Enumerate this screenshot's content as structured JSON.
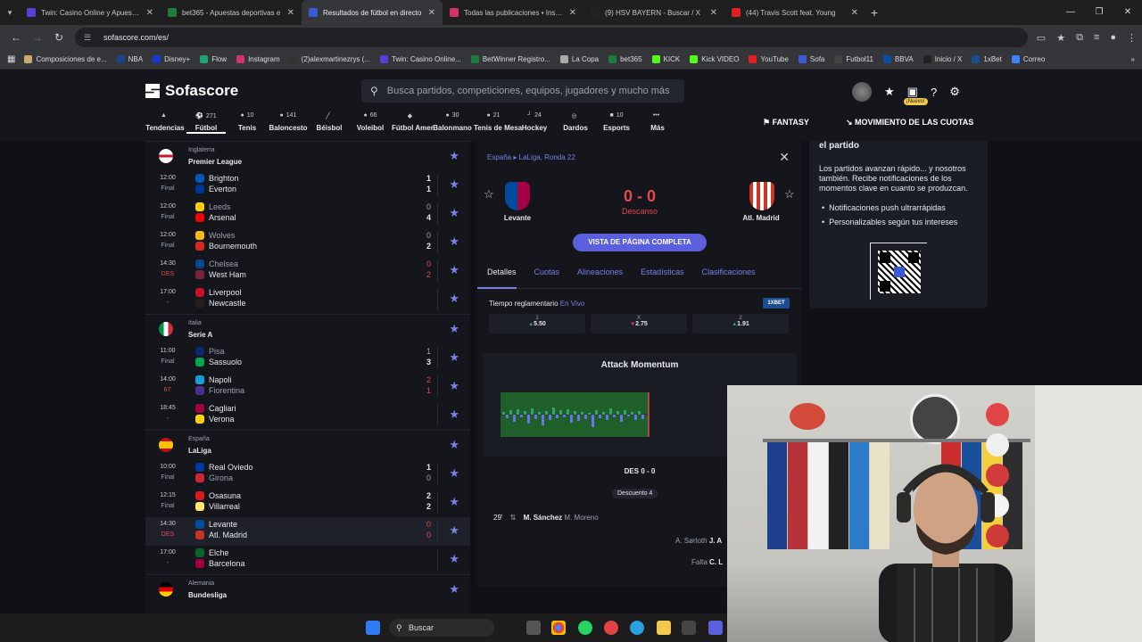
{
  "browser": {
    "tabs": [
      {
        "title": "Twin: Casino Online y Apuestas",
        "color": "#5a3fd6"
      },
      {
        "title": "bet365 - Apuestas deportivas e",
        "color": "#1e7b3c"
      },
      {
        "title": "Resultados de fútbol en directo",
        "color": "#3b5bd6",
        "active": true
      },
      {
        "title": "Todas las publicaciones • Instag",
        "color": "#d6336c"
      },
      {
        "title": "(9) HSV BAYERN - Buscar / X",
        "color": "#222222"
      },
      {
        "title": "(44) Travis Scott feat. Young",
        "color": "#e02020"
      }
    ],
    "url": "sofascore.com/es/",
    "bookmarks": [
      {
        "label": "Composiciones de e...",
        "color": "#c9a96e"
      },
      {
        "label": "NBA",
        "color": "#1d428a"
      },
      {
        "label": "Disney+",
        "color": "#113ccf"
      },
      {
        "label": "Flow",
        "color": "#1ea672"
      },
      {
        "label": "Instagram",
        "color": "#d6336c"
      },
      {
        "label": "(2)alexmartinezrys (...",
        "color": "#333333"
      },
      {
        "label": "Twin: Casino Online...",
        "color": "#5a3fd6"
      },
      {
        "label": "BetWinner Registro...",
        "color": "#1e7b3c"
      },
      {
        "label": "La Copa",
        "color": "#aaaaaa"
      },
      {
        "label": "bet365",
        "color": "#1e7b3c"
      },
      {
        "label": "KICK",
        "color": "#53fc18"
      },
      {
        "label": "Kick VIDEO",
        "color": "#53fc18"
      },
      {
        "label": "YouTube",
        "color": "#e02020"
      },
      {
        "label": "Sofa",
        "color": "#3b5bd6"
      },
      {
        "label": "Futbol11",
        "color": "#444444"
      },
      {
        "label": "BBVA",
        "color": "#0a4ea2"
      },
      {
        "label": "Inicio / X",
        "color": "#222222"
      },
      {
        "label": "1xBet",
        "color": "#1b4d8f"
      },
      {
        "label": "Correo",
        "color": "#3b82f6"
      }
    ]
  },
  "header": {
    "logo": "Sofascore",
    "search_placeholder": "Busca partidos, competiciones, equipos, jugadores y mucho más",
    "nuevo": "¡Nuevo!",
    "fantasy": "FANTASY",
    "odds_movement": "MOVIMIENTO DE LAS CUOTAS"
  },
  "sports": [
    {
      "label": "Tendencias",
      "count": "",
      "icon": "fire-icon"
    },
    {
      "label": "Fútbol",
      "count": "271",
      "icon": "football-icon",
      "selected": true
    },
    {
      "label": "Tenis",
      "count": "10",
      "icon": "tennis-icon"
    },
    {
      "label": "Baloncesto",
      "count": "141",
      "icon": "basketball-icon"
    },
    {
      "label": "Béisbol",
      "count": "",
      "icon": "baseball-icon"
    },
    {
      "label": "Voleibol",
      "count": "66",
      "icon": "volleyball-icon"
    },
    {
      "label": "Fútbol Amer.",
      "count": "",
      "icon": "american-football-icon"
    },
    {
      "label": "Balonmano",
      "count": "30",
      "icon": "handball-icon"
    },
    {
      "label": "Tenis de Mesa",
      "count": "21",
      "icon": "table-tennis-icon"
    },
    {
      "label": "Hockey",
      "count": "24",
      "icon": "hockey-icon"
    },
    {
      "label": "Dardos",
      "count": "",
      "icon": "darts-icon"
    },
    {
      "label": "Esports",
      "count": "10",
      "icon": "esports-icon"
    },
    {
      "label": "Más",
      "count": "",
      "icon": "more-icon"
    }
  ],
  "leagues": [
    {
      "country": "Inglaterra",
      "name": "Premier League",
      "flag": "#ffffff",
      "matches": [
        {
          "time": "12:00",
          "status": "Final",
          "home": "Brighton",
          "away": "Everton",
          "hs": "1",
          "as": "1",
          "hc": "#0057b8",
          "ac": "#003399"
        },
        {
          "time": "12:00",
          "status": "Final",
          "home": "Leeds",
          "away": "Arsenal",
          "hs": "0",
          "as": "4",
          "hc": "#ffcd00",
          "ac": "#ef0107",
          "winner": "away"
        },
        {
          "time": "12:00",
          "status": "Final",
          "home": "Wolves",
          "away": "Bournemouth",
          "hs": "0",
          "as": "2",
          "hc": "#fdb913",
          "ac": "#da291c",
          "winner": "away"
        },
        {
          "time": "14:30",
          "status": "DES",
          "home": "Chelsea",
          "away": "West Ham",
          "hs": "0",
          "as": "2",
          "hc": "#034694",
          "ac": "#7a263a",
          "live": true,
          "winner": "away"
        },
        {
          "time": "17:00",
          "status": "-",
          "home": "Liverpool",
          "away": "Newcastle",
          "hs": "",
          "as": "",
          "hc": "#c8102e",
          "ac": "#241f20",
          "upcoming": true
        }
      ]
    },
    {
      "country": "Italia",
      "name": "Serie A",
      "flag": "#009246",
      "matches": [
        {
          "time": "11:00",
          "status": "Final",
          "home": "Pisa",
          "away": "Sassuolo",
          "hs": "1",
          "as": "3",
          "hc": "#0a2a6b",
          "ac": "#00a752",
          "winner": "away"
        },
        {
          "time": "14:00",
          "status": "67'",
          "home": "Napoli",
          "away": "Fiorentina",
          "hs": "2",
          "as": "1",
          "hc": "#12a0d7",
          "ac": "#482e92",
          "live": true,
          "winner": "home"
        },
        {
          "time": "18:45",
          "status": "-",
          "home": "Cagliari",
          "away": "Verona",
          "hs": "",
          "as": "",
          "hc": "#a50044",
          "ac": "#ffd200",
          "upcoming": true
        }
      ]
    },
    {
      "country": "España",
      "name": "LaLiga",
      "flag": "#c60b1e",
      "matches": [
        {
          "time": "10:00",
          "status": "Final",
          "home": "Real Oviedo",
          "away": "Girona",
          "hs": "1",
          "as": "0",
          "hc": "#0038a8",
          "ac": "#cd2534",
          "winner": "home"
        },
        {
          "time": "12:15",
          "status": "Final",
          "home": "Osasuna",
          "away": "Villarreal",
          "hs": "2",
          "as": "2",
          "hc": "#d91a21",
          "ac": "#ffe667"
        },
        {
          "time": "14:30",
          "status": "DES",
          "home": "Levante",
          "away": "Atl. Madrid",
          "hs": "0",
          "as": "0",
          "hc": "#004a9f",
          "ac": "#cb3524",
          "live": true,
          "highlight": true
        },
        {
          "time": "17:00",
          "status": "-",
          "home": "Elche",
          "away": "Barcelona",
          "hs": "",
          "as": "",
          "hc": "#05642c",
          "ac": "#a50044",
          "upcoming": true
        }
      ]
    },
    {
      "country": "Alemania",
      "name": "Bundesliga",
      "flag": "#000000",
      "matches": []
    }
  ],
  "detail": {
    "breadcrumb_country": "España",
    "breadcrumb_round": "LaLiga, Ronda 22",
    "home": "Levante",
    "away": "Atl. Madrid",
    "score": "0 - 0",
    "status": "Descanso",
    "full_page": "VISTA DE PÁGINA COMPLETA",
    "tabs": [
      "Detalles",
      "Cuotas",
      "Alineaciones",
      "Estadísticas",
      "Clasificaciones"
    ],
    "odds_title": "Tiempo reglamentario",
    "odds_live": "En Vivo",
    "bookie": "1XBET",
    "odds": [
      {
        "label": "1",
        "value": "5.50",
        "dir": "up"
      },
      {
        "label": "X",
        "value": "2.75",
        "dir": "down"
      },
      {
        "label": "2",
        "value": "1.91",
        "dir": "up"
      }
    ],
    "attack_momentum": "Attack Momentum",
    "halftime": "DES 0 - 0",
    "added_time": "Descuento 4",
    "events": [
      {
        "minute": "29'",
        "player": "M. Sánchez",
        "sub": "M. Moreno"
      },
      {
        "minute": "",
        "player": "A. Sørloth",
        "sub": "J. A"
      },
      {
        "minute": "",
        "player": "Falta",
        "sub": "C. L"
      }
    ]
  },
  "promo": {
    "title": "el partido",
    "text": "Los partidos avanzan rápido... y nosotros también. Recibe notificaciones de los momentos clave en cuanto se produzcan.",
    "bullets": [
      "Notificaciones push ultrarrápidas",
      "Personalizables según tus intereses"
    ]
  },
  "taskbar": {
    "search": "Buscar"
  }
}
